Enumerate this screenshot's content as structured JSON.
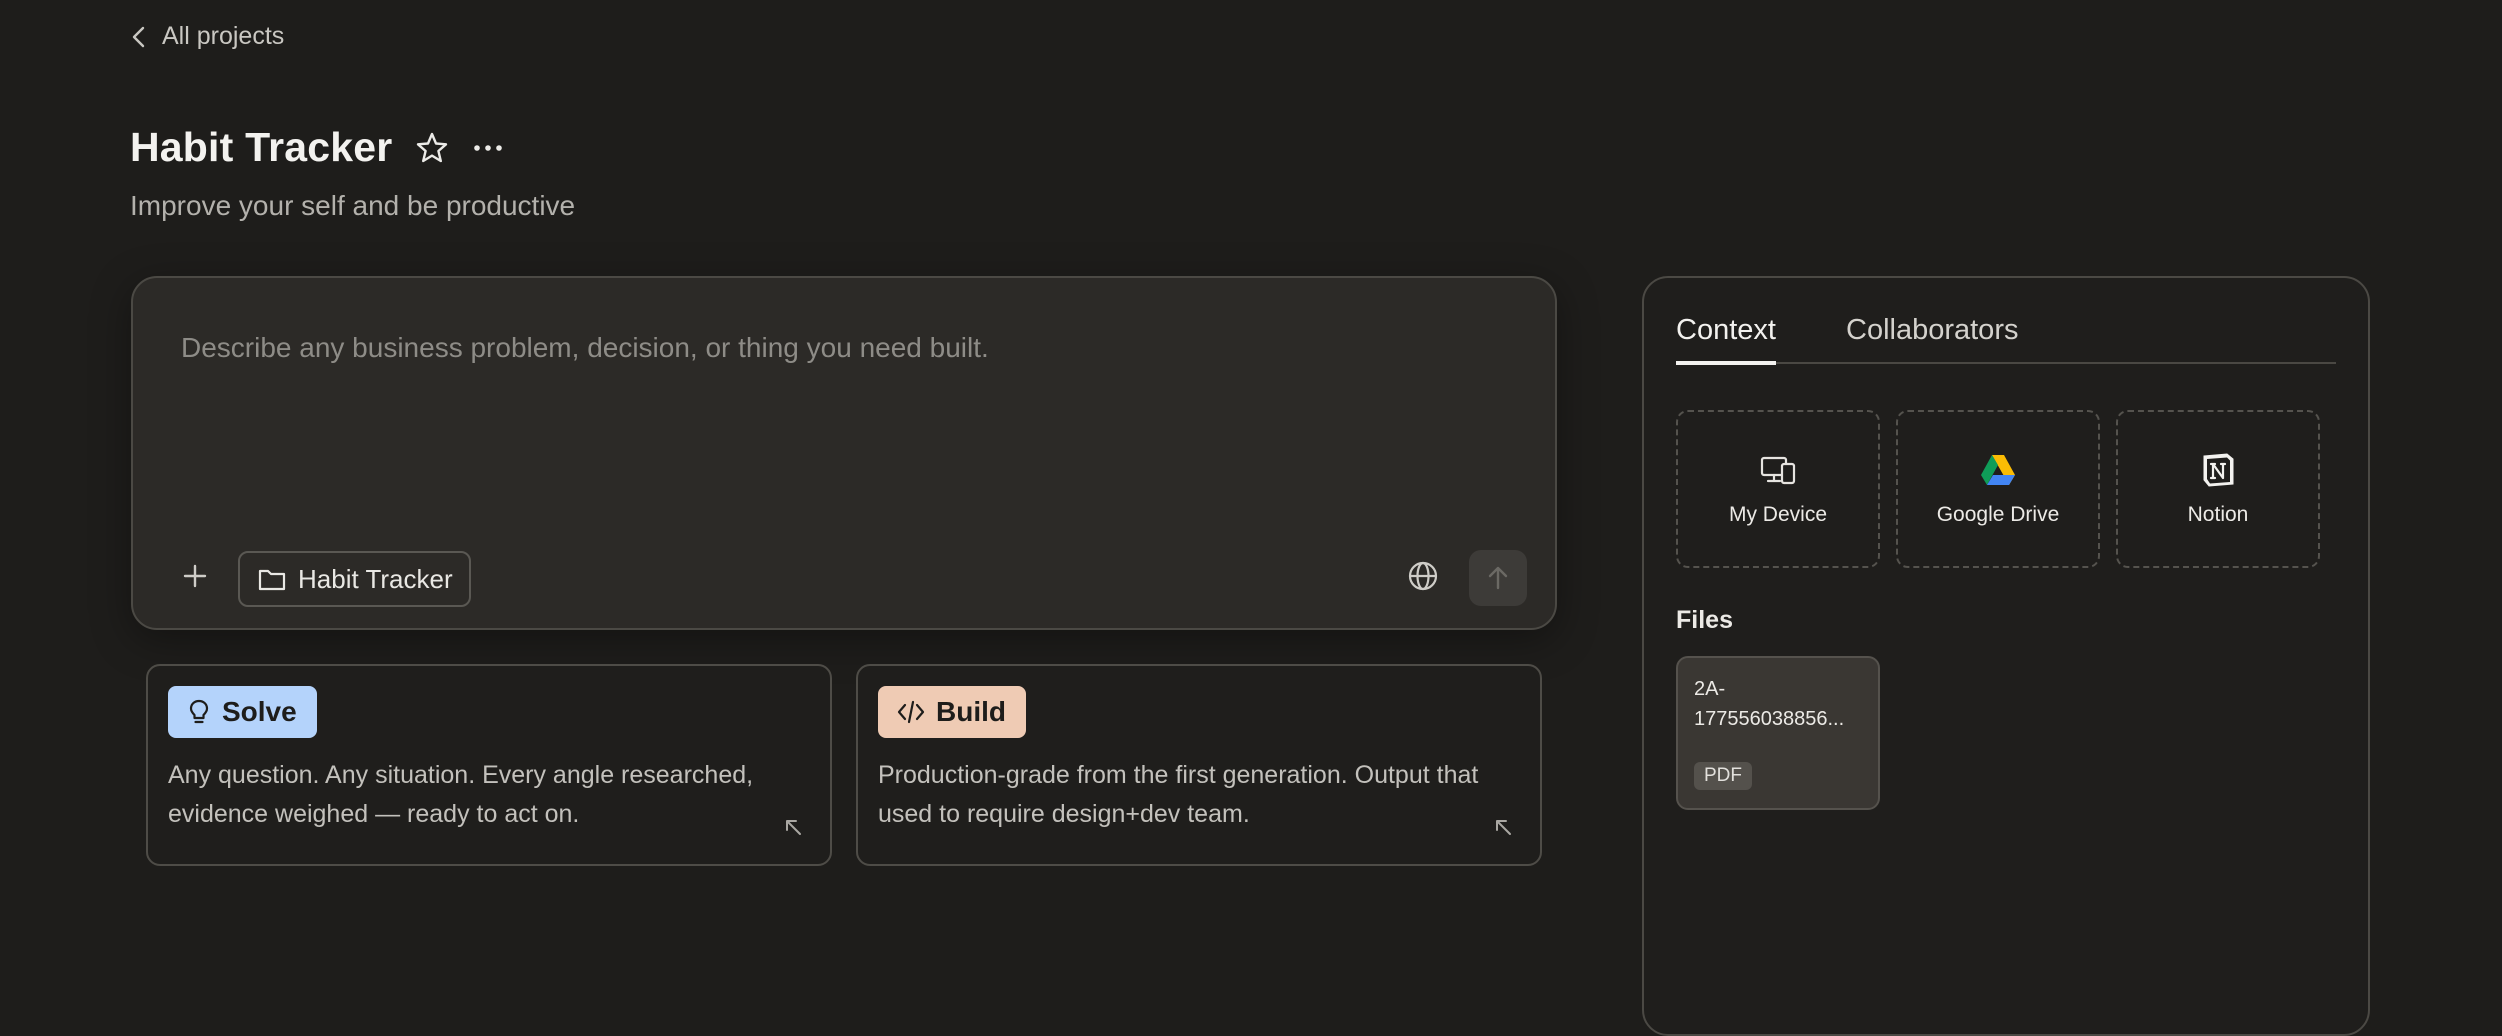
{
  "nav": {
    "back_label": "All projects"
  },
  "project": {
    "title": "Habit Tracker",
    "description": "Improve your self and be productive"
  },
  "composer": {
    "placeholder": "Describe any business problem, decision, or thing you need built.",
    "value": "",
    "folder_chip": "Habit Tracker"
  },
  "modes": [
    {
      "label": "Solve",
      "description": "Any question. Any situation. Every angle researched, evidence weighed — ready to act on.",
      "color": "#b4d3fb",
      "icon": "lightbulb-icon"
    },
    {
      "label": "Build",
      "description": "Production-grade from the first generation. Output that used to require design+dev team.",
      "color": "#efcbb4",
      "icon": "code-icon"
    }
  ],
  "sidebar": {
    "tabs": [
      {
        "label": "Context",
        "active": true
      },
      {
        "label": "Collaborators",
        "active": false
      }
    ],
    "sources": [
      {
        "label": "My Device",
        "icon": "device-icon"
      },
      {
        "label": "Google Drive",
        "icon": "google-drive-icon"
      },
      {
        "label": "Notion",
        "icon": "notion-icon"
      }
    ],
    "files_heading": "Files",
    "files": [
      {
        "name_line1": "2A-",
        "name_line2": "177556038856...",
        "type": "PDF"
      }
    ]
  }
}
